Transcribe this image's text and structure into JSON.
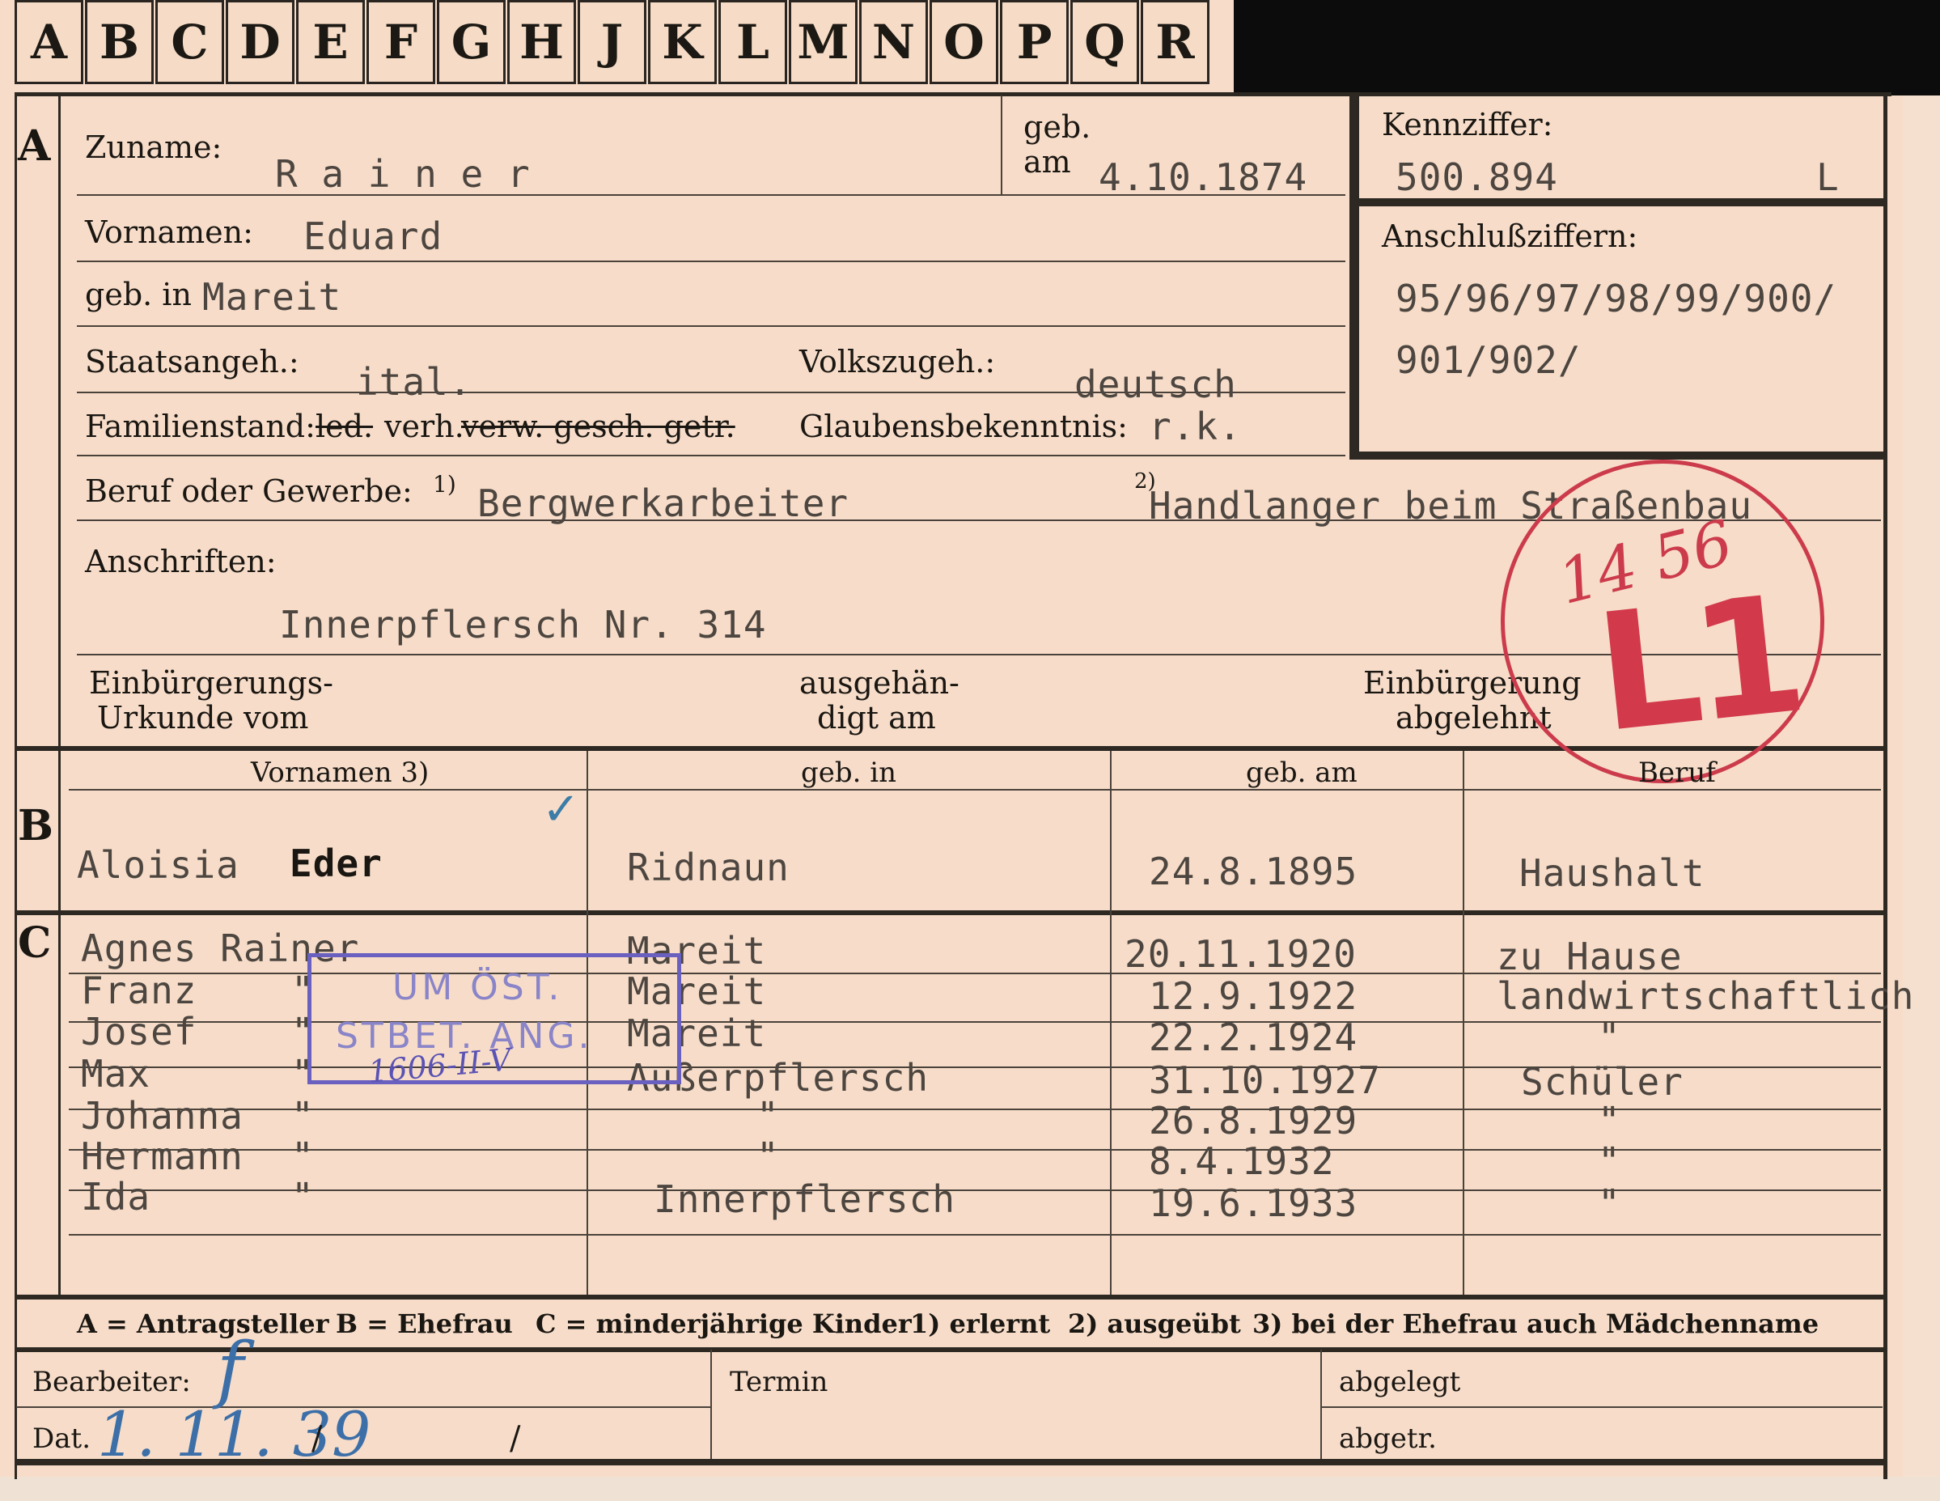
{
  "alphabet_tabs": [
    "A",
    "B",
    "C",
    "D",
    "E",
    "F",
    "G",
    "H",
    "J",
    "K",
    "L",
    "M",
    "N",
    "O",
    "P",
    "Q",
    "R"
  ],
  "sections": {
    "a": "A",
    "b": "B",
    "c": "C"
  },
  "applicant": {
    "surname_label": "Zuname:",
    "surname": "R a i n e r",
    "birth_label_1": "geb.",
    "birth_label_2": "am",
    "birth_date": "4.10.1874",
    "code_label": "Kennziffer:",
    "code": "500.894",
    "code_suffix": "L",
    "connect_label": "Anschlußziffern:",
    "connect_1": "95/96/97/98/99/900/",
    "connect_2": "901/902/",
    "firstname_label": "Vornamen:",
    "firstname": "Eduard",
    "birthplace_label": "geb. in",
    "birthplace": "Mareit",
    "citizenship_label": "Staatsangeh.:",
    "citizenship": "ital.",
    "ethnicity_label": "Volkszugeh.:",
    "ethnicity": "deutsch",
    "status_label": "Familienstand:",
    "status_led": "led.",
    "status_verh": "verh.",
    "status_rest": "verw. gesch. getr.",
    "religion_label": "Glaubensbekenntnis:",
    "religion": "r.k.",
    "occupation_label": "Beruf oder Gewerbe:",
    "occ_mark_1": "1)",
    "occupation_1": "Bergwerkarbeiter",
    "occ_mark_2": "2)",
    "occupation_2": "Handlanger beim Straßenbau",
    "address_label": "Anschriften:",
    "address": "Innerpflersch Nr. 314",
    "naturalization_label_1": "Einbürgerungs-",
    "naturalization_label_2": "Urkunde vom",
    "issued_label_1": "ausgehän-",
    "issued_label_2": "digt am",
    "refused_label_1": "Einbürgerung",
    "refused_label_2": "abgelehnt"
  },
  "stamp_red": {
    "number": "14 56",
    "code": "L1"
  },
  "wife": {
    "headers": [
      "Vornamen 3)",
      "geb. in",
      "geb. am",
      "Beruf"
    ],
    "first": "Aloisia",
    "maiden": "Eder",
    "place": "Ridnaun",
    "date": "24.8.1895",
    "job": "Haushalt"
  },
  "children": [
    {
      "name": "Agnes Rainer",
      "mark": "",
      "place": "Mareit",
      "date": "20.11.1920",
      "job": "zu Hause"
    },
    {
      "name": "Franz",
      "mark": "\"",
      "place": "Mareit",
      "date": "12.9.1922",
      "job": "landwirtschaftlich"
    },
    {
      "name": "Josef",
      "mark": "\"",
      "place": "Mareit",
      "date": "22.2.1924",
      "job": "\""
    },
    {
      "name": "Max",
      "mark": "\"",
      "place": "Außerpflersch",
      "date": "31.10.1927",
      "job": "Schüler"
    },
    {
      "name": "Johanna",
      "mark": "\"",
      "place": "\"",
      "date": "26.8.1929",
      "job": "\""
    },
    {
      "name": "Hermann",
      "mark": "\"",
      "place": "\"",
      "date": "8.4.1932",
      "job": "\""
    },
    {
      "name": "Ida",
      "mark": "\"",
      "place": "Innerpflersch",
      "date": "19.6.1933",
      "job": "\""
    }
  ],
  "stamp_blue": {
    "line1": "UM ÖST.",
    "line2": "STBET. ANG.",
    "line3": "1606-II-V"
  },
  "legend": {
    "a": "A = Antragsteller",
    "b": "B = Ehefrau",
    "c": "C = minderjährige Kinder",
    "n1": "1) erlernt",
    "n2": "2) ausgeübt",
    "n3": "3) bei der Ehefrau auch Mädchenname"
  },
  "footer": {
    "clerk_label": "Bearbeiter:",
    "clerk_sign": "f",
    "date_label": "Dat.",
    "date": "1. 11. 39",
    "slash": "/",
    "term_label": "Termin",
    "filed_label": "abgelegt",
    "removed_label": "abgetr."
  },
  "colors": {
    "card": "#f7ddc9",
    "ink": "#1a1612",
    "type": "#4d4640",
    "stamp_red": "#cc3b4c",
    "stamp_blue": "#6a60c0",
    "pencil_blue": "#3c6fa8"
  }
}
